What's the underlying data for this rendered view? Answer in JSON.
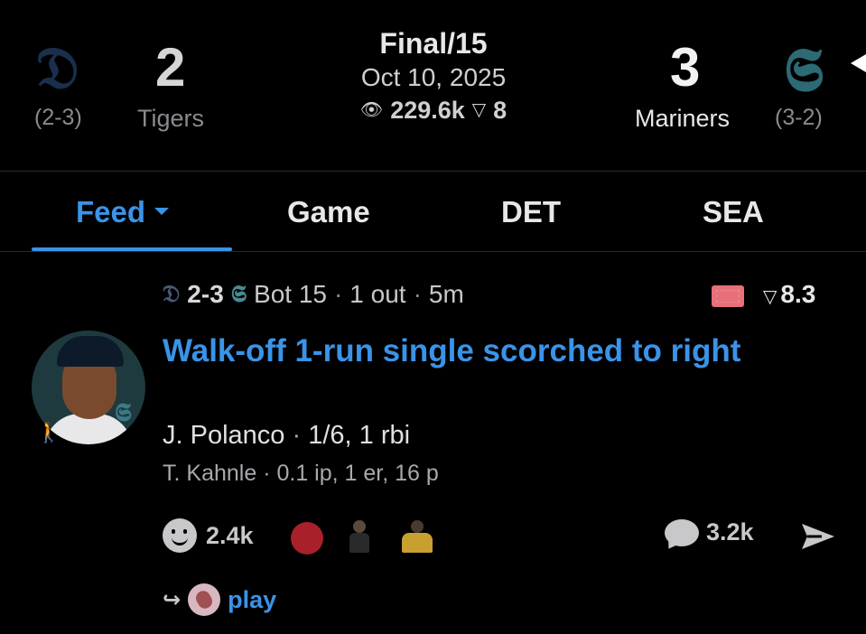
{
  "game": {
    "away": {
      "logo": "𝔇",
      "score": "2",
      "name": "Tigers",
      "record": "(2-3)"
    },
    "home": {
      "logo": "𝕾",
      "score": "3",
      "name": "Mariners",
      "record": "(3-2)"
    },
    "status": "Final/15",
    "date": "Oct 10, 2025",
    "views": "229.6k",
    "rating": "8",
    "eye_icon": "👁",
    "rating_icon": "▽"
  },
  "tabs": [
    {
      "label": "Feed",
      "active": true
    },
    {
      "label": "Game"
    },
    {
      "label": "DET"
    },
    {
      "label": "SEA"
    }
  ],
  "play": {
    "score_line": "2-3",
    "away_mini_logo": "𝔇",
    "home_mini_logo": "𝕾",
    "inning": "Bot 15",
    "outs": "1 out",
    "age": "5m",
    "rating": "8.3",
    "rating_icon": "▽",
    "headline": "Walk-off 1-run single scorched to right",
    "batter_name": "J. Polanco",
    "batter_line": "1/6, 1 rbi",
    "pitcher_name": "T. Kahnle",
    "pitcher_line": "0.1 ip, 1 er, 16 p",
    "reactions_count": "2.4k",
    "comments_count": "3.2k",
    "reply_label": "play",
    "runner_icon": "🚶",
    "reply_icon": "↪",
    "sep": "·"
  },
  "colors": {
    "accent": "#3a93e8",
    "background": "#000000",
    "muted": "#8a8a8f"
  }
}
